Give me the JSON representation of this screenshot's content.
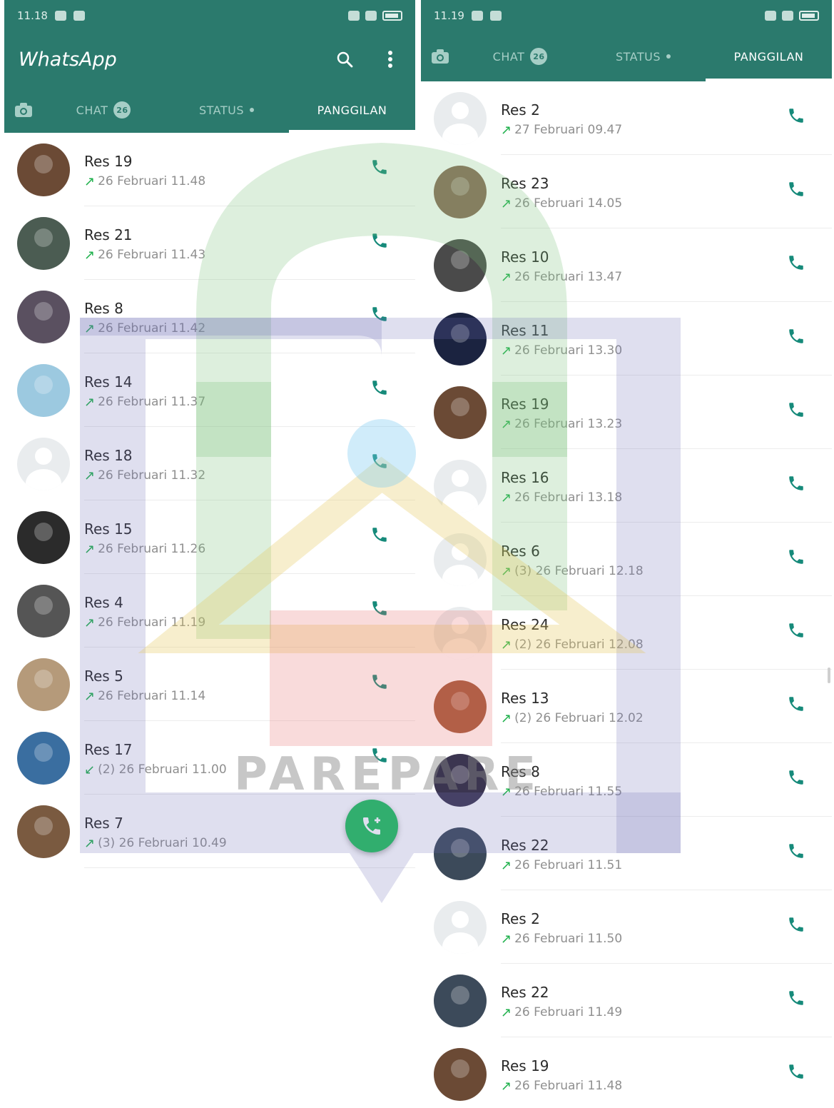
{
  "left": {
    "status_time": "11.18",
    "app_title": "WhatsApp",
    "tabs": {
      "chat": "CHAT",
      "chat_badge": "26",
      "status": "STATUS",
      "calls": "PANGGILAN"
    },
    "calls": [
      {
        "name": "Res 19",
        "direction": "out",
        "meta": "26 Februari 11.48",
        "avatar": "#6b4a35"
      },
      {
        "name": "Res 21",
        "direction": "out",
        "meta": "26 Februari 11.43",
        "avatar": "#4b5c52"
      },
      {
        "name": "Res 8",
        "direction": "out",
        "meta": "26 Februari 11.42",
        "avatar": "#5a5060"
      },
      {
        "name": "Res 14",
        "direction": "out",
        "meta": "26 Februari 11.37",
        "avatar": "#9cc9e0"
      },
      {
        "name": "Res 18",
        "direction": "out",
        "meta": "26 Februari 11.32",
        "avatar": "default"
      },
      {
        "name": "Res 15",
        "direction": "out",
        "meta": "26 Februari 11.26",
        "avatar": "#2b2b2b"
      },
      {
        "name": "Res 4",
        "direction": "out",
        "meta": "26 Februari 11.19",
        "avatar": "#555555"
      },
      {
        "name": "Res 5",
        "direction": "out",
        "meta": "26 Februari 11.14",
        "avatar": "#b59a7a"
      },
      {
        "name": "Res 17",
        "direction": "in",
        "meta": "(2) 26 Februari 11.00",
        "avatar": "#3a6ea0"
      },
      {
        "name": "Res 7",
        "direction": "out",
        "meta": "(3) 26 Februari 10.49",
        "avatar": "#7a5a40"
      }
    ]
  },
  "right": {
    "status_time": "11.19",
    "tabs": {
      "chat": "CHAT",
      "chat_badge": "26",
      "status": "STATUS",
      "calls": "PANGGILAN"
    },
    "calls": [
      {
        "name": "Res 2",
        "direction": "out",
        "meta": "27 Februari 09.47",
        "avatar": "default"
      },
      {
        "name": "Res 23",
        "direction": "out",
        "meta": "26 Februari 14.05",
        "avatar": "#8a6a58"
      },
      {
        "name": "Res 10",
        "direction": "out",
        "meta": "26 Februari 13.47",
        "avatar": "#4a4a4a"
      },
      {
        "name": "Res 11",
        "direction": "out",
        "meta": "26 Februari 13.30",
        "avatar": "#1b2340"
      },
      {
        "name": "Res 19",
        "direction": "out",
        "meta": "26 Februari 13.23",
        "avatar": "#6b4a35"
      },
      {
        "name": "Res 16",
        "direction": "out",
        "meta": "26 Februari 13.18",
        "avatar": "default"
      },
      {
        "name": "Res 6",
        "direction": "out",
        "meta": "(3) 26 Februari 12.18",
        "avatar": "default"
      },
      {
        "name": "Res 24",
        "direction": "out",
        "meta": "(2) 26 Februari 12.08",
        "avatar": "default"
      },
      {
        "name": "Res 13",
        "direction": "out",
        "meta": "(2) 26 Februari 12.02",
        "avatar": "#a05a3a"
      },
      {
        "name": "Res 8",
        "direction": "out",
        "meta": "26 Februari 11.55",
        "avatar": "#3b3550"
      },
      {
        "name": "Res 22",
        "direction": "out",
        "meta": "26 Februari 11.51",
        "avatar": "#3c4a5a"
      },
      {
        "name": "Res 2",
        "direction": "out",
        "meta": "26 Februari 11.50",
        "avatar": "default"
      },
      {
        "name": "Res 22",
        "direction": "out",
        "meta": "26 Februari 11.49",
        "avatar": "#3c4a5a"
      },
      {
        "name": "Res 19",
        "direction": "out",
        "meta": "26 Februari 11.48",
        "avatar": "#6b4a35"
      }
    ]
  },
  "watermark": {
    "text": "PAREPARE"
  },
  "colors": {
    "primary": "#2b7a6d",
    "accent": "#20c05a",
    "call_icon": "#168a7a"
  },
  "icons": {
    "search": "search-icon",
    "menu": "more-vert-icon",
    "camera": "camera-icon",
    "call": "phone-icon",
    "new_call": "add-call-icon"
  }
}
